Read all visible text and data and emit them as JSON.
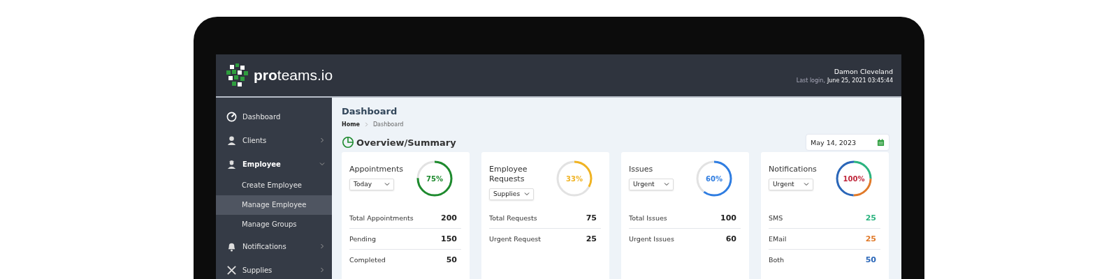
{
  "header": {
    "logo": "**pro**teams.io",
    "user_name": "Damon Cleveland",
    "last_login_label": "Last login,",
    "last_login_value": "June 25, 2021 03:45:44"
  },
  "sidebar": {
    "items": [
      {
        "label": "Dashboard",
        "selected": false
      },
      {
        "label": "Clients",
        "selected": false,
        "expanded": false
      },
      {
        "label": "Employee",
        "selected": false,
        "expanded": true,
        "children": [
          {
            "label": "Create Employee",
            "selected": false
          },
          {
            "label": "Manage Employee",
            "selected": true
          },
          {
            "label": "Manage Groups",
            "selected": false
          }
        ]
      },
      {
        "label": "Notifications",
        "selected": false,
        "expanded": false
      },
      {
        "label": "Supplies",
        "selected": false,
        "expanded": false
      }
    ]
  },
  "page": {
    "title": "Dashboard",
    "breadcrumb": [
      "Home",
      "Dashboard"
    ],
    "section_title": "Overview/Summary",
    "date": "May 14, 2023"
  },
  "cards": [
    {
      "title": "Appointments",
      "filter": "Today",
      "kind": "single",
      "level": 0.75,
      "percent": "75%",
      "color": "#1e8a2e",
      "rows": [
        {
          "label": "Total Appointments",
          "value": "200"
        },
        {
          "label": "Pending",
          "value": "150"
        },
        {
          "label": "Completed",
          "value": "50"
        }
      ]
    },
    {
      "title": "Employee Requests",
      "filter": "Supplies",
      "kind": "single",
      "level": 0.33,
      "percent": "33%",
      "color": "#f0b323",
      "rows": [
        {
          "label": "Total Requests",
          "value": "75"
        },
        {
          "label": "Urgent Request",
          "value": "25"
        }
      ]
    },
    {
      "title": "Issues",
      "filter": "Urgent",
      "kind": "single",
      "level": 0.6,
      "percent": "60%",
      "color": "#2f7de1",
      "rows": [
        {
          "label": "Total Issues",
          "value": "100"
        },
        {
          "label": "Urgent Issues",
          "value": "60"
        }
      ]
    },
    {
      "title": "Notifications",
      "filter": "Urgent",
      "kind": "segmented",
      "percent": "100%",
      "color": "#c0283c",
      "rows": [
        {
          "label": "SMS",
          "value": "25",
          "color": "#2bb37f"
        },
        {
          "label": "EMail",
          "value": "25",
          "color": "#e07a2a"
        },
        {
          "label": "Both",
          "value": "50",
          "color": "#2a66b8"
        }
      ]
    }
  ]
}
